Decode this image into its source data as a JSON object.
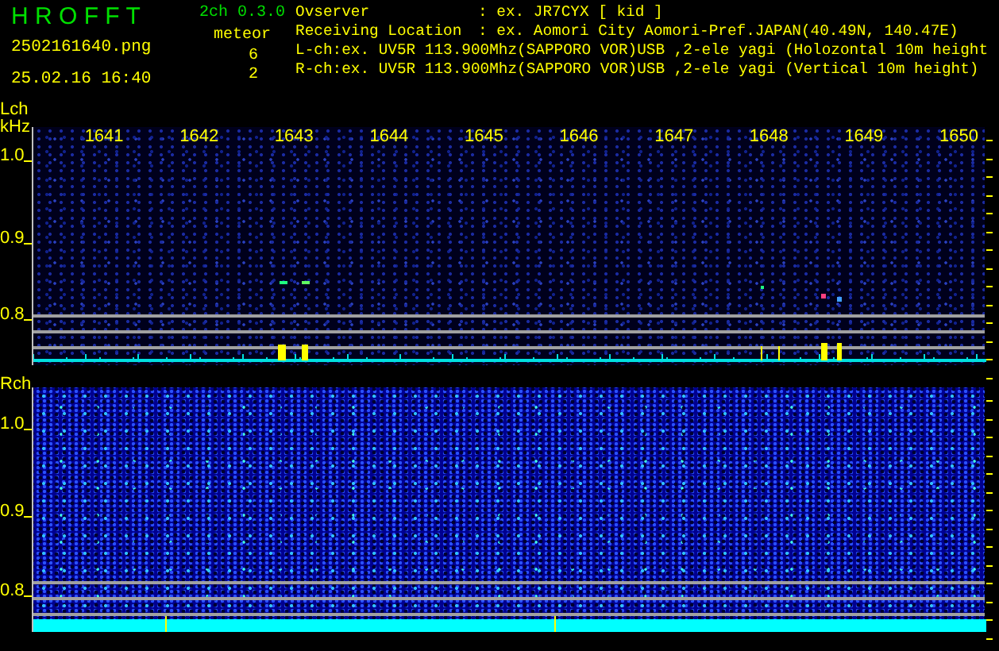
{
  "header": {
    "app_title": "H R O F F T",
    "version": "2ch 0.3.0",
    "filename": "2502161640.png",
    "datetime": "25.02.16 16:40",
    "meteor_label": "meteor",
    "meteor_counts": [
      "6",
      "2"
    ],
    "info": [
      {
        "kind": "field",
        "label": "Ovserver",
        "value": ": ex. JR7CYX [ kid ]"
      },
      {
        "kind": "field",
        "label": "Receiving Location",
        "value": ": ex. Aomori City Aomori-Pref.JAPAN(40.49N, 140.47E)"
      },
      {
        "kind": "line",
        "text": "L-ch:ex. UV5R 113.900Mhz(SAPPORO VOR)USB ,2-ele yagi (Holozontal 10m height"
      },
      {
        "kind": "line",
        "text": "R-ch:ex. UV5R 113.900Mhz(SAPPORO VOR)USB ,2-ele yagi (Vertical 10m height)"
      }
    ]
  },
  "panels": [
    {
      "kind": "sparse",
      "channel": "Lch",
      "unit": "kHz",
      "freq_labels": [
        "1641",
        "1642",
        "1643",
        "1644",
        "1645",
        "1646",
        "1647",
        "1648",
        "1649",
        "1650"
      ],
      "y_labels": [
        "1.0",
        "0.9",
        "0.8"
      ]
    },
    {
      "kind": "dense",
      "channel": "Rch",
      "y_labels": [
        "1.0",
        "0.9",
        "0.8"
      ]
    }
  ]
}
